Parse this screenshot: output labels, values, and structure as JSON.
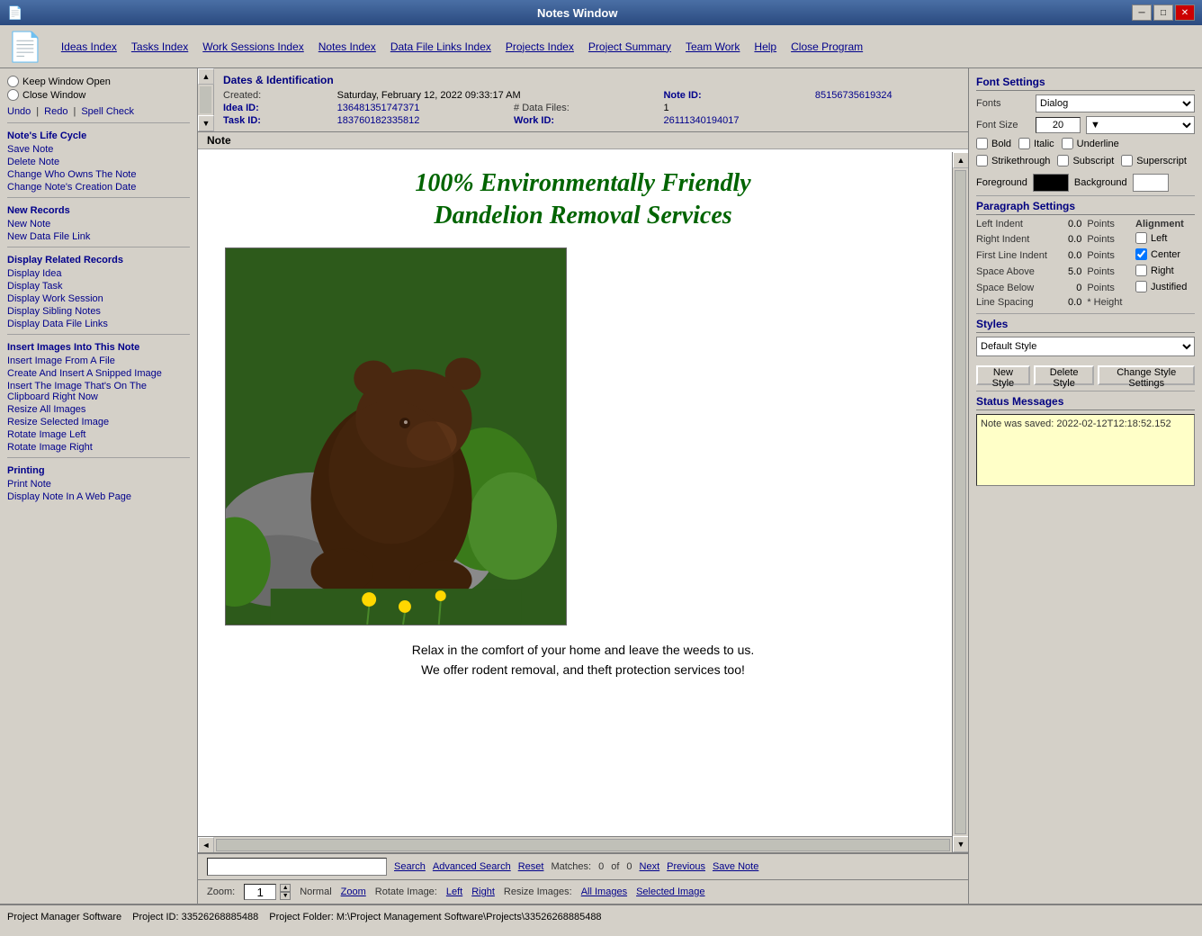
{
  "titleBar": {
    "title": "Notes Window",
    "icon": "📄",
    "minBtn": "─",
    "maxBtn": "□",
    "closeBtn": "✕"
  },
  "menuBar": {
    "appIcon": "📄",
    "items": [
      {
        "id": "ideas-index",
        "label": "Ideas Index"
      },
      {
        "id": "tasks-index",
        "label": "Tasks Index"
      },
      {
        "id": "work-sessions-index",
        "label": "Work Sessions Index"
      },
      {
        "id": "notes-index",
        "label": "Notes Index"
      },
      {
        "id": "data-file-links-index",
        "label": "Data File Links Index"
      },
      {
        "id": "projects-index",
        "label": "Projects Index"
      },
      {
        "id": "project-summary",
        "label": "Project Summary"
      },
      {
        "id": "team-work",
        "label": "Team Work"
      },
      {
        "id": "help",
        "label": "Help"
      },
      {
        "id": "close-program",
        "label": "Close Program"
      }
    ]
  },
  "leftPanel": {
    "keepWindowOpen": "Keep Window Open",
    "closeWindow": "Close Window",
    "undo": "Undo",
    "redo": "Redo",
    "spellCheck": "Spell Check",
    "notesLifeCycle": {
      "title": "Note's Life Cycle",
      "items": [
        "Save Note",
        "Delete Note",
        "Change Who Owns The Note",
        "Change Note's Creation Date"
      ]
    },
    "newRecords": {
      "title": "New Records",
      "items": [
        "New Note",
        "New Data File Link"
      ]
    },
    "displayRelatedRecords": {
      "title": "Display Related Records",
      "items": [
        "Display Idea",
        "Display Task",
        "Display Work Session",
        "Display Sibling Notes",
        "Display Data File Links"
      ]
    },
    "insertImages": {
      "title": "Insert Images Into This Note",
      "items": [
        "Insert Image From A File",
        "Create And Insert A Snipped Image",
        "Insert The Image That's On The Clipboard Right Now",
        "Resize All Images",
        "Resize Selected Image",
        "Rotate Image Left",
        "Rotate Image Right"
      ]
    },
    "printing": {
      "title": "Printing",
      "items": [
        "Print Note",
        "Display Note In A Web Page"
      ]
    }
  },
  "dates": {
    "sectionTitle": "Dates & Identification",
    "createdLabel": "Created:",
    "createdValue": "Saturday, February 12, 2022   09:33:17 AM",
    "dataFilesLabel": "# Data Files:",
    "dataFilesValue": "1",
    "noteIdLabel": "Note ID:",
    "noteIdValue": "85156735619324",
    "ideaIdLabel": "Idea ID:",
    "ideaIdValue": "136481351747371",
    "taskIdLabel": "Task ID:",
    "taskIdValue": "183760182335812",
    "workIdLabel": "Work ID:",
    "workIdValue": "26111340194017"
  },
  "note": {
    "sectionTitle": "Note",
    "titleLine1": "100% Environmentally Friendly",
    "titleLine2": "Dandelion Removal Services",
    "captionLine1": "Relax in the comfort of your home and leave the weeds to us.",
    "captionLine2": "We offer rodent removal, and theft protection services too!"
  },
  "searchBar": {
    "searchLabel": "Search",
    "advancedSearchLabel": "Advanced Search",
    "resetLabel": "Reset",
    "matchesLabel": "Matches:",
    "matchesValue": "0",
    "ofLabel": "of",
    "ofValue": "0",
    "nextLabel": "Next",
    "previousLabel": "Previous",
    "saveNoteLabel": "Save Note"
  },
  "zoomBar": {
    "zoomLabel": "Zoom:",
    "zoomValue": "1",
    "normalLabel": "Normal",
    "zoomLinkLabel": "Zoom",
    "rotateImageLabel": "Rotate Image:",
    "leftLabel": "Left",
    "rightLabel": "Right",
    "resizeImagesLabel": "Resize Images:",
    "allImagesLabel": "All Images",
    "selectedImageLabel": "Selected Image"
  },
  "rightPanel": {
    "fontSettings": {
      "title": "Font Settings",
      "fontLabel": "Fonts",
      "fontValue": "Dialog",
      "fontSizeLabel": "Font Size",
      "fontSizeValue": "20",
      "boldLabel": "Bold",
      "italicLabel": "Italic",
      "underlineLabel": "Underline",
      "strikethroughLabel": "Strikethrough",
      "subscriptLabel": "Subscript",
      "superscriptLabel": "Superscript",
      "foregroundLabel": "Foreground",
      "foregroundColor": "#000000",
      "backgroundLabel": "Background",
      "backgroundColor": "#ffffff"
    },
    "paragraphSettings": {
      "title": "Paragraph Settings",
      "leftIndentLabel": "Left Indent",
      "leftIndentValue": "0.0",
      "rightIndentLabel": "Right Indent",
      "rightIndentValue": "0.0",
      "firstLineIndentLabel": "First Line Indent",
      "firstLineIndentValue": "0.0",
      "spaceAboveLabel": "Space Above",
      "spaceAboveValue": "5.0",
      "spaceBelowLabel": "Space Below",
      "spaceBelowValue": "0",
      "lineSpacingLabel": "Line Spacing",
      "lineSpacingValue": "0.0",
      "pointsLabel": "Points",
      "alignmentLabel": "Alignment",
      "leftAlignLabel": "Left",
      "centerAlignLabel": "Center",
      "rightAlignLabel": "Right",
      "justifiedLabel": "Justified",
      "heightLabel": "* Height"
    },
    "styles": {
      "title": "Styles",
      "defaultStyle": "Default Style",
      "newStyleBtn": "New Style",
      "deleteStyleBtn": "Delete Style",
      "changeStyleSettingsBtn": "Change Style Settings"
    },
    "statusMessages": {
      "title": "Status Messages",
      "message": "Note was saved:  2022-02-12T12:18:52.152"
    }
  },
  "statusBar": {
    "software": "Project Manager Software",
    "projectId": "Project ID:  33526268885488",
    "projectFolder": "Project Folder: M:\\Project Management Software\\Projects\\33526268885488"
  }
}
